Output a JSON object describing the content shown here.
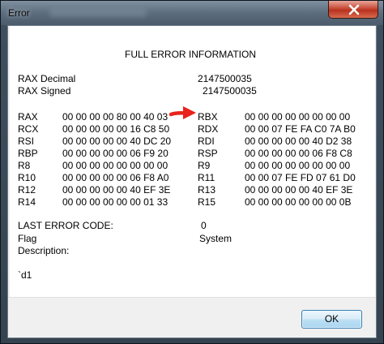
{
  "window": {
    "title": "Error",
    "close_icon": "close-icon"
  },
  "dialog": {
    "heading": "FULL ERROR INFORMATION",
    "rax_decimal_label": "RAX Decimal",
    "rax_decimal_value": "2147500035",
    "rax_signed_label": "RAX Signed",
    "rax_signed_value": "2147500035",
    "registers": [
      {
        "left_name": "RAX",
        "left_value": "00 00 00 00 80 00 40 03",
        "right_name": "RBX",
        "right_value": "00 00 00 00 00 00 00 00"
      },
      {
        "left_name": "RCX",
        "left_value": "00 00 00 00 00 16 C8 50",
        "right_name": "RDX",
        "right_value": "00 00 07 FE FA C0 7A B0"
      },
      {
        "left_name": "RSI",
        "left_value": "00 00 00 00 00 40 DC 20",
        "right_name": "RDI",
        "right_value": "00 00 00 00 00 40 D2 38"
      },
      {
        "left_name": "RBP",
        "left_value": "00 00 00 00 00 06 F9 20",
        "right_name": "RSP",
        "right_value": "00 00 00 00 00 06 F8 C8"
      },
      {
        "left_name": "R8",
        "left_value": "00 00 00 00 00 00 00 00",
        "right_name": "R9",
        "right_value": "00 00 00 00 00 00 00 00"
      },
      {
        "left_name": "R10",
        "left_value": "00 00 00 00 00 06 F8 A0",
        "right_name": "R11",
        "right_value": "00 00 07 FE FD 07 61 D0"
      },
      {
        "left_name": "R12",
        "left_value": "00 00 00 00 00 40 EF 3E",
        "right_name": "R13",
        "right_value": "00 00 00 00 00 40 EF 3E"
      },
      {
        "left_name": "R14",
        "left_value": "00 00 00 00 00 00 01 33",
        "right_name": "R15",
        "right_value": "00 00 00 00 00 00 00 0B"
      }
    ],
    "last_error_label": "LAST ERROR CODE:",
    "last_error_value": "0",
    "flag_label": "Flag",
    "flag_value": "System",
    "description_label": "Description:",
    "description_value": "`d1"
  },
  "buttons": {
    "ok_label": "OK"
  },
  "colors": {
    "annotation_arrow": "#e8231b",
    "ok_border": "#3c7fb1"
  }
}
